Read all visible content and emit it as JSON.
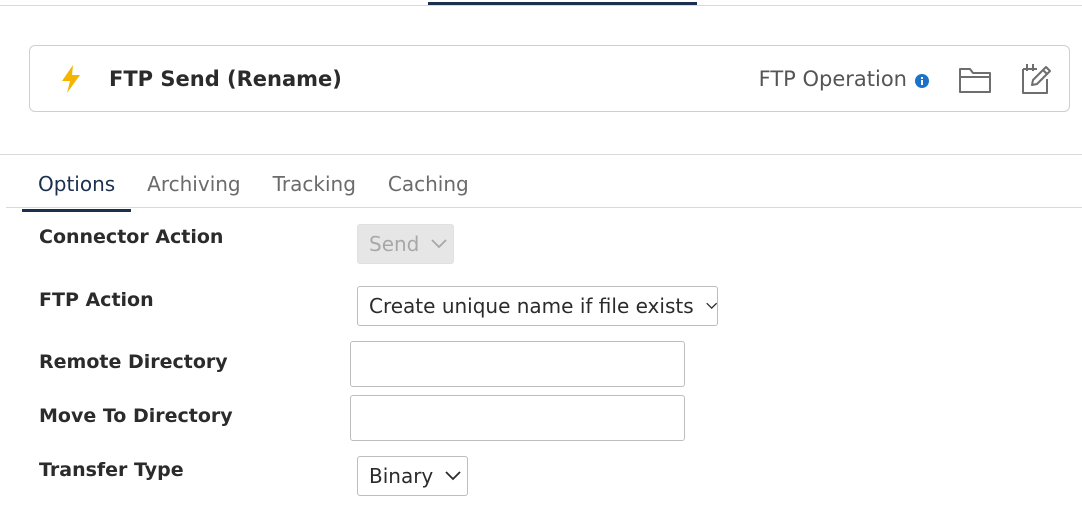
{
  "operation": {
    "title": "FTP Send (Rename)",
    "type_label": "FTP Operation",
    "icons": {
      "bolt": "bolt-icon",
      "info": "info-icon",
      "folder": "folder-icon",
      "edit": "edit-icon"
    },
    "colors": {
      "bolt": "#f5b400",
      "info": "#1a73c9",
      "accent": "#1b2f4f"
    }
  },
  "tabs": [
    {
      "label": "Options",
      "active": true
    },
    {
      "label": "Archiving",
      "active": false
    },
    {
      "label": "Tracking",
      "active": false
    },
    {
      "label": "Caching",
      "active": false
    }
  ],
  "fields": {
    "connector_action": {
      "label": "Connector Action",
      "value": "Send",
      "disabled": true
    },
    "ftp_action": {
      "label": "FTP Action",
      "value": "Create unique name if file exists"
    },
    "remote_directory": {
      "label": "Remote Directory",
      "value": ""
    },
    "move_to_directory": {
      "label": "Move To Directory",
      "value": ""
    },
    "transfer_type": {
      "label": "Transfer Type",
      "value": "Binary"
    }
  }
}
